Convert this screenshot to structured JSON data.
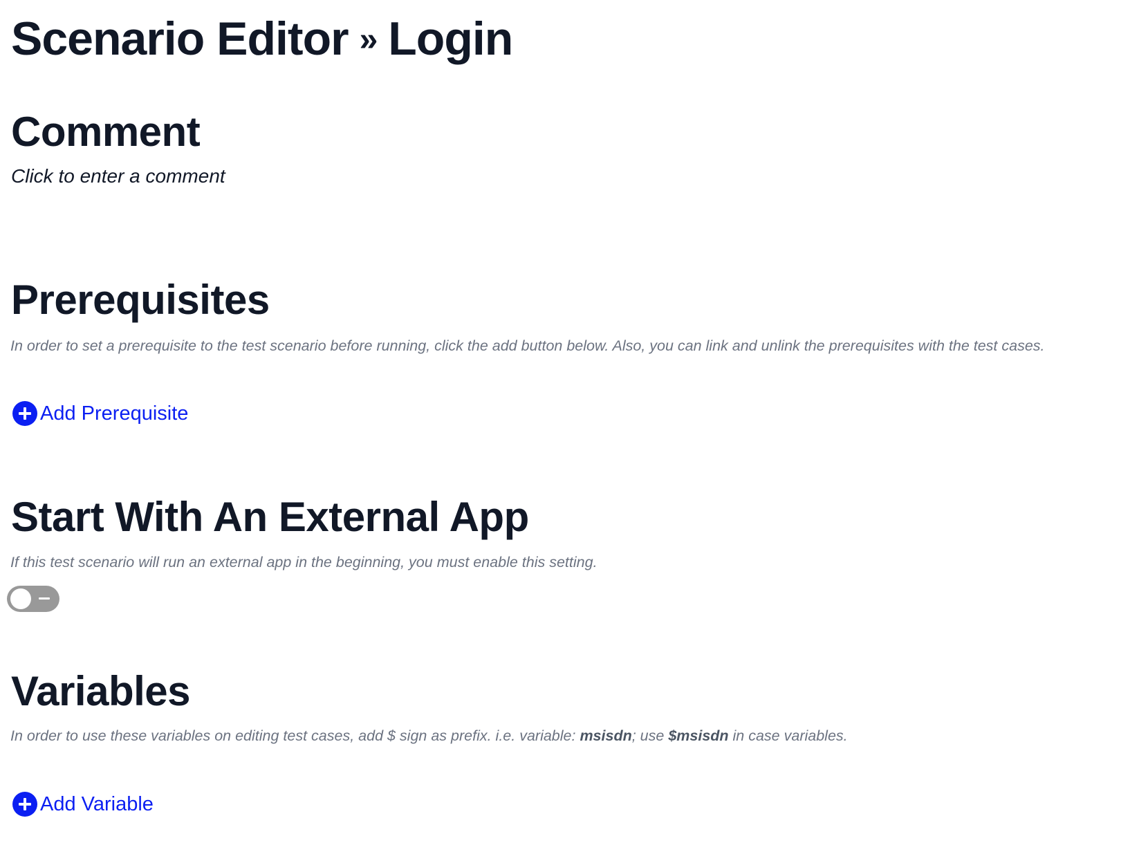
{
  "header": {
    "section": "Scenario Editor",
    "separator": "»",
    "page": "Login"
  },
  "comment": {
    "heading": "Comment",
    "placeholder": "Click to enter a comment"
  },
  "prerequisites": {
    "heading": "Prerequisites",
    "description": "In order to set a prerequisite to the test scenario before running, click the add button below. Also, you can link and unlink the prerequisites with the test cases.",
    "add_label": "Add Prerequisite"
  },
  "external_app": {
    "heading": "Start With An External App",
    "description": "If this test scenario will run an external app in the beginning, you must enable this setting.",
    "toggle_enabled": false
  },
  "variables": {
    "heading": "Variables",
    "description_part1": "In order to use these variables on editing test cases, add $ sign as prefix. i.e. variable: ",
    "example_variable": "msisdn",
    "description_part2": "; use ",
    "example_usage": "$msisdn",
    "description_part3": " in case variables.",
    "add_label": "Add Variable"
  },
  "colors": {
    "heading_text": "#111827",
    "muted_text": "#6b7280",
    "accent_blue": "#0b1ff2",
    "toggle_off": "#999999"
  },
  "icons": {
    "add_prerequisite": "plus-circle-icon",
    "add_variable": "plus-circle-icon"
  }
}
